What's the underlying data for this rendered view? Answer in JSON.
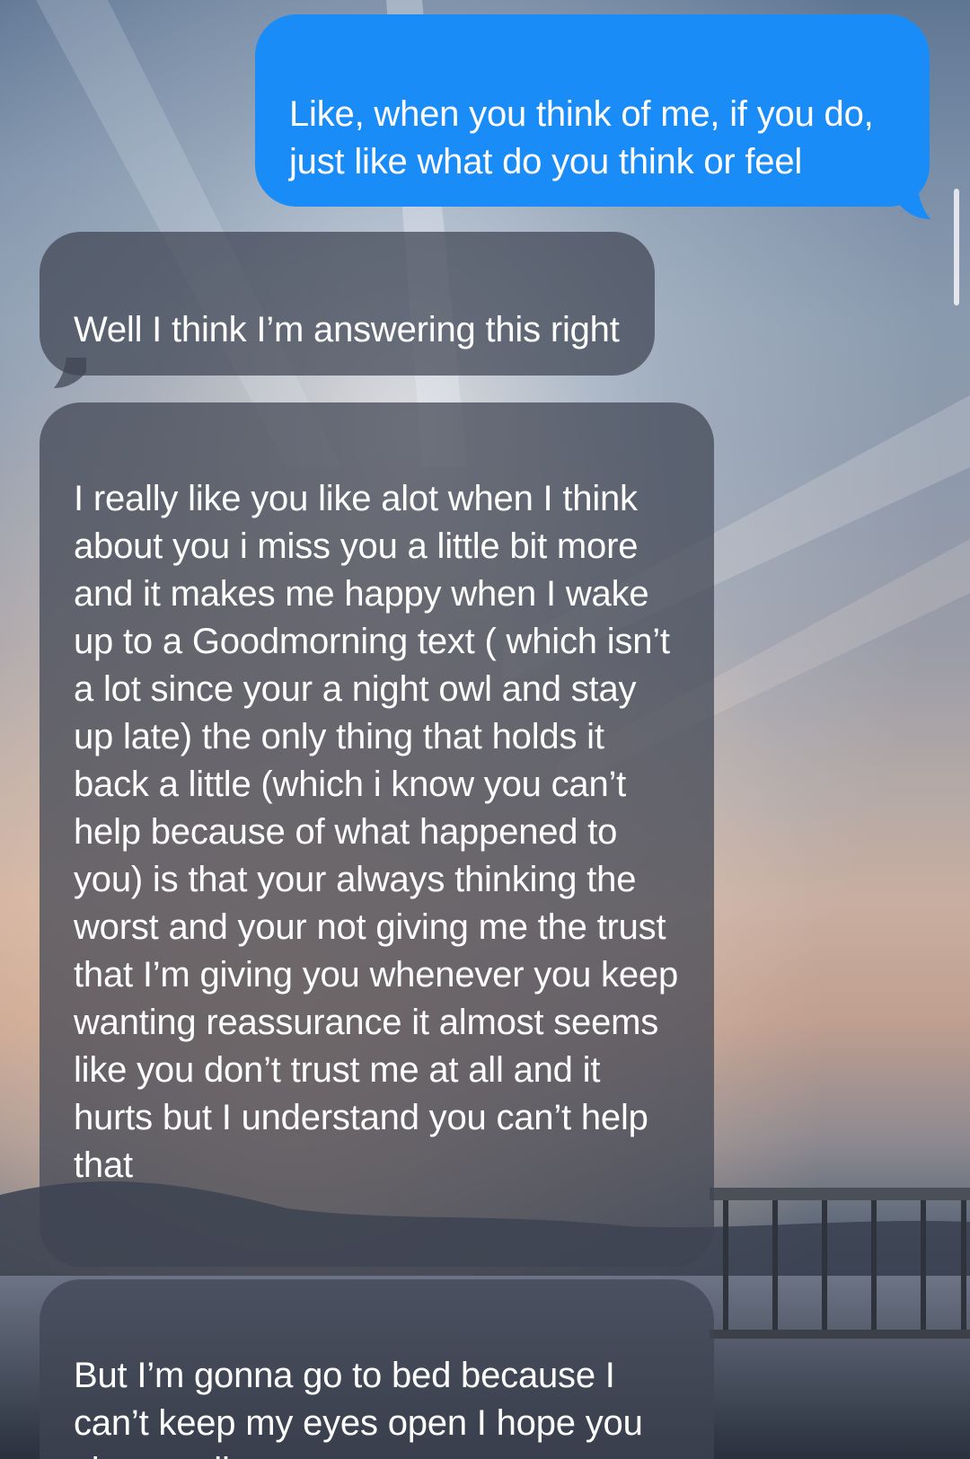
{
  "wallpaper": {
    "description_icon": "sunset-lake-photo"
  },
  "colors": {
    "sent_bubble": "#1a8cf7",
    "received_bubble": "#3e4452",
    "text": "#ffffff"
  },
  "messages": [
    {
      "direction": "sent",
      "text": "Like, when you think of me, if you do, just like what do you think or feel"
    },
    {
      "direction": "received",
      "text": "Well I think I’m answering this right"
    },
    {
      "direction": "received",
      "text": "I really like you like alot when I think about you i miss you a little bit more and it makes me happy when I wake up to a Goodmorning text ( which isn’t a lot since your a night owl and stay up late) the only thing that holds it back a little (which i know you can’t help because of what happened to you) is that your always thinking the worst and your not giving me the trust that I’m giving you whenever you keep wanting reassurance it almost seems like you don’t trust me at all and it hurts but I understand you can’t help that"
    },
    {
      "direction": "received",
      "text": "But I’m gonna go to bed because I can’t keep my eyes open I hope you sleep well"
    }
  ]
}
